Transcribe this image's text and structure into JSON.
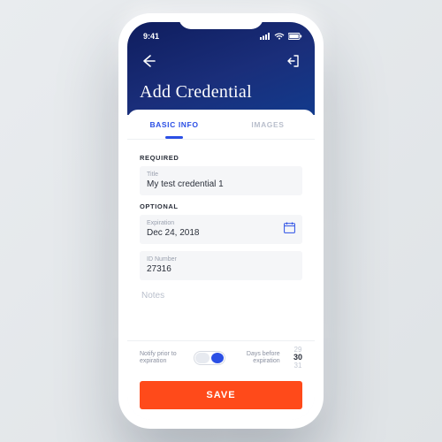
{
  "status": {
    "time": "9:41"
  },
  "header": {
    "title": "Add Credential"
  },
  "tabs": [
    {
      "label": "BASIC INFO",
      "active": true
    },
    {
      "label": "IMAGES",
      "active": false
    }
  ],
  "sections": {
    "required_label": "REQUIRED",
    "optional_label": "OPTIONAL"
  },
  "fields": {
    "title": {
      "label": "Title",
      "value": "My test credential 1"
    },
    "expiration": {
      "label": "Expiration",
      "value": "Dec 24, 2018"
    },
    "idnumber": {
      "label": "ID Number",
      "value": "27316"
    },
    "notes": {
      "placeholder": "Notes"
    }
  },
  "notify": {
    "left_label": "Notify prior to expiration",
    "right_label": "Days before expiration",
    "wheel": {
      "prev": "29",
      "selected": "30",
      "next": "31"
    },
    "enabled": true
  },
  "actions": {
    "save": "SAVE"
  },
  "colors": {
    "accent": "#2b4fe5",
    "primary_action": "#ff4a1a"
  }
}
